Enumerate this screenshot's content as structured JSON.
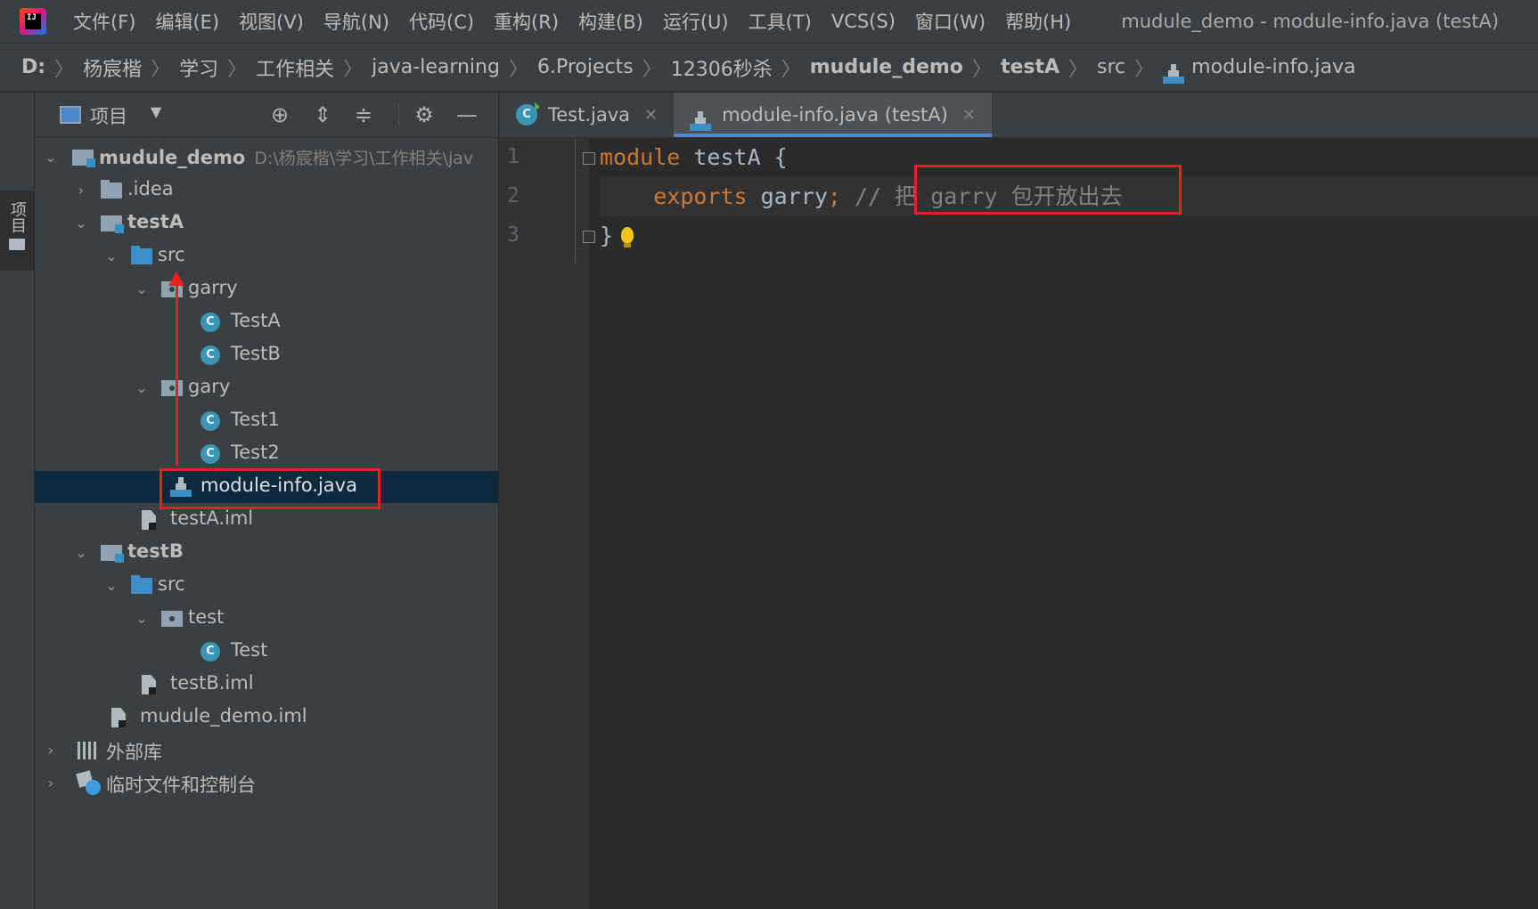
{
  "menubar": {
    "items": [
      "文件(F)",
      "编辑(E)",
      "视图(V)",
      "导航(N)",
      "代码(C)",
      "重构(R)",
      "构建(B)",
      "运行(U)",
      "工具(T)",
      "VCS(S)",
      "窗口(W)",
      "帮助(H)"
    ],
    "window_title": "mudule_demo - module-info.java (testA)"
  },
  "breadcrumb": {
    "items": [
      "D:",
      "杨宸楷",
      "学习",
      "工作相关",
      "java-learning",
      "6.Projects",
      "12306秒杀",
      "mudule_demo",
      "testA",
      "src",
      "module-info.java"
    ]
  },
  "stripe": {
    "tab_label": "项目"
  },
  "project_panel": {
    "title": "项目",
    "tree": [
      {
        "label": "mudule_demo",
        "hint": "D:\\杨宸楷\\学习\\工作相关\\jav"
      },
      {
        "label": ".idea"
      },
      {
        "label": "testA"
      },
      {
        "label": "src"
      },
      {
        "label": "garry"
      },
      {
        "label": "TestA"
      },
      {
        "label": "TestB"
      },
      {
        "label": "gary"
      },
      {
        "label": "Test1"
      },
      {
        "label": "Test2"
      },
      {
        "label": "module-info.java"
      },
      {
        "label": "testA.iml"
      },
      {
        "label": "testB"
      },
      {
        "label": "src"
      },
      {
        "label": "test"
      },
      {
        "label": "Test"
      },
      {
        "label": "testB.iml"
      },
      {
        "label": "mudule_demo.iml"
      },
      {
        "label": "外部库"
      },
      {
        "label": "临时文件和控制台"
      }
    ]
  },
  "editor": {
    "tabs": [
      {
        "label": "Test.java",
        "active": false
      },
      {
        "label": "module-info.java (testA)",
        "active": true
      }
    ],
    "line_numbers": [
      "1",
      "2",
      "3"
    ],
    "code": {
      "line1": {
        "kw": "module",
        "rest": " testA {"
      },
      "line2": {
        "indent": "    ",
        "kw": "exports",
        "ident": " garry",
        "semi": ";",
        "comment_prefix": " //",
        "comment": " 把 garry 包开放出去"
      },
      "line3": {
        "text": "}"
      }
    }
  },
  "colors": {
    "annotation_red": "#e52222",
    "keyword": "#cc7832",
    "comment": "#808080",
    "selection": "#0d293e",
    "accent": "#4a88c7"
  }
}
